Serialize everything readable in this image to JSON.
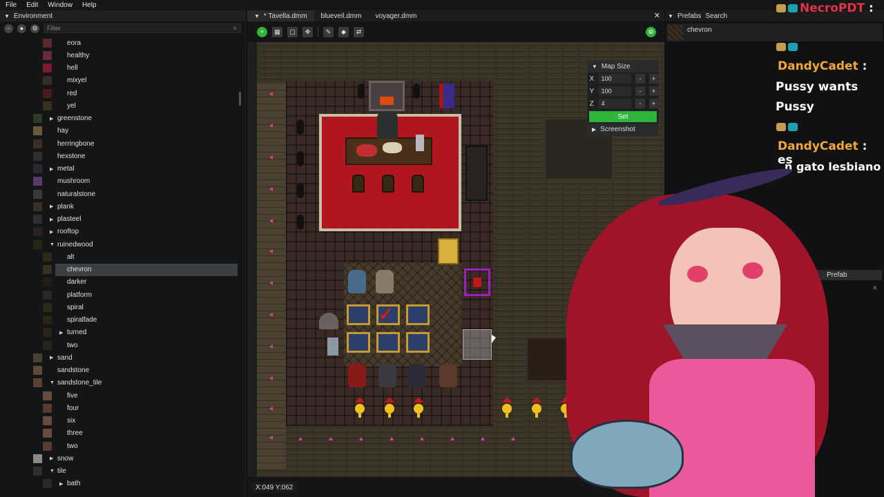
{
  "menu": [
    "File",
    "Edit",
    "Window",
    "Help"
  ],
  "left_panel": {
    "title": "Environment",
    "filter_placeholder": "Filter",
    "rows": [
      {
        "label": "eora",
        "indent": 2,
        "color": "#5a2a2a",
        "arrow": ""
      },
      {
        "label": "healthy",
        "indent": 2,
        "color": "#6a2a3a",
        "arrow": ""
      },
      {
        "label": "hell",
        "indent": 2,
        "color": "#7a1c2c",
        "arrow": ""
      },
      {
        "label": "mixyel",
        "indent": 2,
        "color": "#3a2a2a",
        "arrow": ""
      },
      {
        "label": "red",
        "indent": 2,
        "color": "#4a1a1a",
        "arrow": ""
      },
      {
        "label": "yel",
        "indent": 2,
        "color": "#3a3022",
        "arrow": ""
      },
      {
        "label": "greenstone",
        "indent": 1,
        "color": "#2e3a2a",
        "arrow": "▶"
      },
      {
        "label": "hay",
        "indent": 1,
        "color": "#6a5a3a",
        "arrow": ""
      },
      {
        "label": "herringbone",
        "indent": 1,
        "color": "#3a2e26",
        "arrow": ""
      },
      {
        "label": "hexstone",
        "indent": 1,
        "color": "#2e2e2e",
        "arrow": ""
      },
      {
        "label": "metal",
        "indent": 1,
        "color": "#2a2a2e",
        "arrow": "▶"
      },
      {
        "label": "mushroom",
        "indent": 1,
        "color": "#5a3a6a",
        "arrow": ""
      },
      {
        "label": "naturalstone",
        "indent": 1,
        "color": "#3a3a36",
        "arrow": ""
      },
      {
        "label": "plank",
        "indent": 1,
        "color": "#3a3022",
        "arrow": "▶"
      },
      {
        "label": "plasteel",
        "indent": 1,
        "color": "#2e2e32",
        "arrow": "▶"
      },
      {
        "label": "rooftop",
        "indent": 1,
        "color": "#2a2220",
        "arrow": "▶"
      },
      {
        "label": "ruinedwood",
        "indent": 1,
        "color": "#2a2418",
        "arrow": "▼"
      },
      {
        "label": "alt",
        "indent": 2,
        "color": "#2e2a1a",
        "arrow": ""
      },
      {
        "label": "chevron",
        "indent": 2,
        "color": "#3a2d22",
        "arrow": "",
        "selected": true
      },
      {
        "label": "darker",
        "indent": 2,
        "color": "#221e16",
        "arrow": ""
      },
      {
        "label": "platform",
        "indent": 2,
        "color": "#2e2820",
        "arrow": ""
      },
      {
        "label": "spiral",
        "indent": 2,
        "color": "#2e2818",
        "arrow": ""
      },
      {
        "label": "spiralfade",
        "indent": 2,
        "color": "#2a2418",
        "arrow": ""
      },
      {
        "label": "turned",
        "indent": 2,
        "color": "#2a2418",
        "arrow": "▶"
      },
      {
        "label": "two",
        "indent": 2,
        "color": "#2a2418",
        "arrow": ""
      },
      {
        "label": "sand",
        "indent": 1,
        "color": "#4a4030",
        "arrow": "▶"
      },
      {
        "label": "sandstone",
        "indent": 1,
        "color": "#5a4a38",
        "arrow": ""
      },
      {
        "label": "sandstone_tile",
        "indent": 1,
        "color": "#5a4034",
        "arrow": "▼"
      },
      {
        "label": "five",
        "indent": 2,
        "color": "#6a4a40",
        "arrow": ""
      },
      {
        "label": "four",
        "indent": 2,
        "color": "#5a3a30",
        "arrow": ""
      },
      {
        "label": "six",
        "indent": 2,
        "color": "#6a4a40",
        "arrow": ""
      },
      {
        "label": "three",
        "indent": 2,
        "color": "#6a4a40",
        "arrow": ""
      },
      {
        "label": "two",
        "indent": 2,
        "color": "#5a3a30",
        "arrow": ""
      },
      {
        "label": "snow",
        "indent": 1,
        "color": "#8a8a8a",
        "arrow": "▶"
      },
      {
        "label": "tile",
        "indent": 1,
        "color": "#2e2e2e",
        "arrow": "▼"
      },
      {
        "label": "bath",
        "indent": 2,
        "color": "#2a2a2a",
        "arrow": "▶"
      }
    ]
  },
  "editor": {
    "tabs": [
      "* Tavella.dmm",
      "blueveil.dmm",
      "voyager.dmm"
    ],
    "close_icon": "close-icon",
    "map_size": {
      "title": "Map Size",
      "x": "100",
      "y": "100",
      "z": "4",
      "set_label": "Set",
      "screenshot_label": "Screenshot"
    },
    "coords": "X:049 Y:062"
  },
  "right_panel": {
    "tabs": [
      "Prefabs",
      "Search"
    ],
    "item": "chevron",
    "section_label": "Prefab"
  },
  "chat": {
    "header_name": "NecroPDT",
    "messages": [
      {
        "user": "DandyCadet",
        "text": [
          "Pussy wants",
          "Pussy"
        ]
      },
      {
        "user": "DandyCadet",
        "text": [
          "es",
          "n gato lesbiano"
        ]
      }
    ]
  },
  "colors": {
    "accent_green": "#2fb53a",
    "chat_user": "#f2a833",
    "chat_header": "#e0334a"
  }
}
